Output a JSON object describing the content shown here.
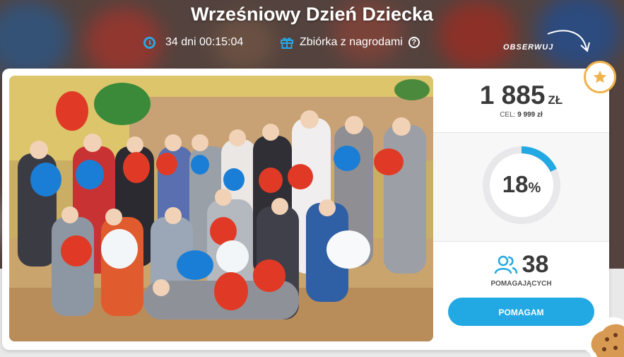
{
  "campaign": {
    "title": "Wrześniowy Dzień Dziecka",
    "time_left": "34 dni 00:15:04",
    "reward_label": "Zbiórka z nagrodami",
    "help_symbol": "?",
    "follow_label": "OBSERWUJ"
  },
  "funding": {
    "amount": "1 885",
    "currency": "ZŁ",
    "goal_label": "CEL:",
    "goal_value": "9 999 zł",
    "progress_percent": 18,
    "percent_value": "18",
    "percent_sign": "%"
  },
  "supporters": {
    "count": "38",
    "label": "POMAGAJĄCYCH"
  },
  "actions": {
    "help_button": "POMAGAM"
  },
  "colors": {
    "accent": "#22a8e2",
    "star": "#f0b24a",
    "text": "#3a3a3a"
  },
  "icons": [
    "clock-icon",
    "gift-icon",
    "help-icon",
    "star-icon",
    "people-icon",
    "cookie-icon"
  ]
}
